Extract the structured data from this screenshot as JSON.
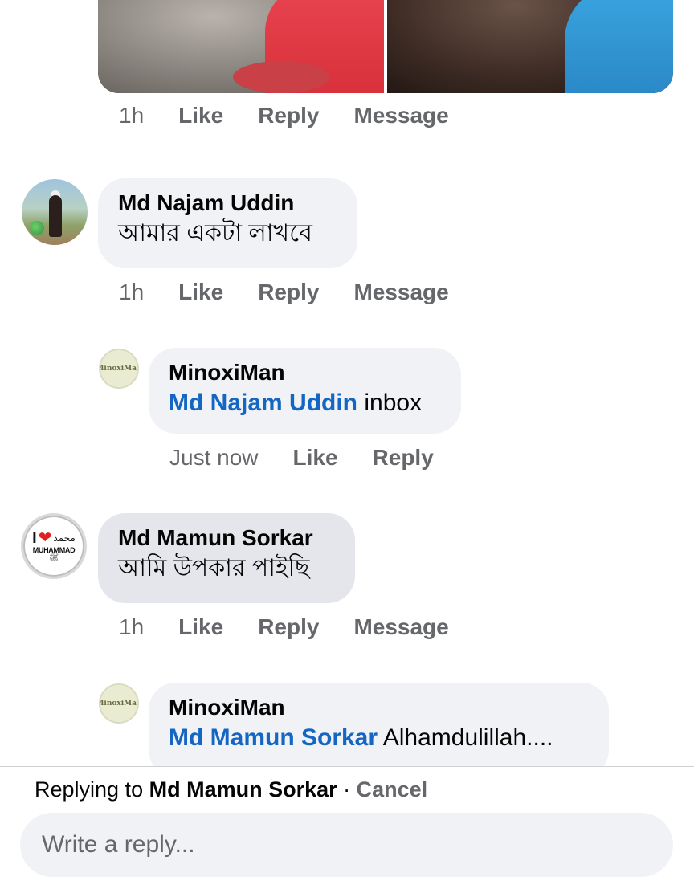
{
  "post_image": {
    "icon": "photo-collage"
  },
  "comments": [
    {
      "time": "1h",
      "like": "Like",
      "reply": "Reply",
      "message": "Message"
    },
    {
      "author": "Md Najam Uddin",
      "text": "আমার একটা লাখবে",
      "time": "1h",
      "like": "Like",
      "reply": "Reply",
      "message": "Message",
      "reply_item": {
        "author": "MinoxiMan",
        "mention": "Md Najam Uddin",
        "text": " inbox",
        "time": "Just now",
        "like": "Like",
        "reply": "Reply",
        "avatar_text": "MinoxiMan"
      }
    },
    {
      "author": "Md Mamun Sorkar",
      "text": "আমি উপকার পাইছি",
      "time": "1h",
      "like": "Like",
      "reply": "Reply",
      "message": "Message",
      "avatar": {
        "line1": "I",
        "heart": "❤",
        "arabic": "محمد",
        "word": "MUHAMMAD",
        "calligraphy": "ﷺ"
      },
      "reply_item": {
        "author": "MinoxiMan",
        "mention": "Md Mamun Sorkar",
        "text": " Alhamdulillah....",
        "avatar_text": "MinoxiMan"
      }
    }
  ],
  "composer": {
    "replying_prefix": "Replying to ",
    "replying_to": "Md Mamun Sorkar",
    "separator": " · ",
    "cancel": "Cancel",
    "placeholder": "Write a reply..."
  }
}
